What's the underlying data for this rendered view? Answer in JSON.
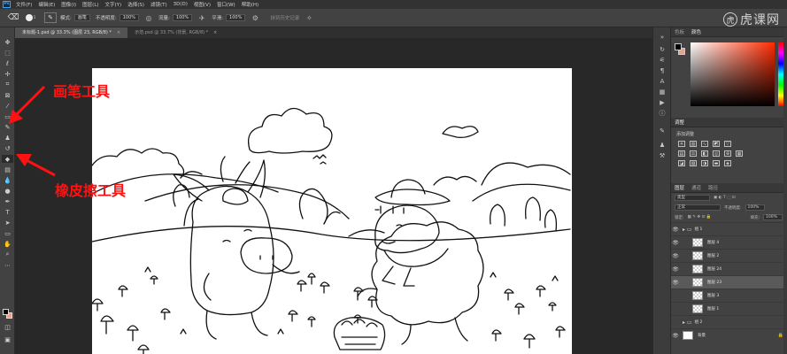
{
  "app": {
    "logo": "Ps"
  },
  "menu": [
    "文件(F)",
    "编辑(E)",
    "图像(I)",
    "图层(L)",
    "文字(Y)",
    "选择(S)",
    "滤镜(T)",
    "3D(D)",
    "视图(V)",
    "窗口(W)",
    "帮助(H)"
  ],
  "options": {
    "tool_icon": "eraser-icon",
    "brush_size": "1",
    "mode_label": "模式:",
    "mode_value": "画笔",
    "opacity_label": "不透明度:",
    "opacity_value": "100%",
    "flow_label": "流量:",
    "flow_value": "100%",
    "smooth_label": "平滑:",
    "smooth_value": "100%",
    "history_label": "抹到历史记录"
  },
  "watermark": {
    "logo": "虎",
    "text": "虎课网"
  },
  "tabs": [
    {
      "label": "未标题-1.psd @ 33.3% (图层 23, RGB/8) *",
      "close": "×"
    },
    {
      "label": "示范.psd @ 33.7% (背景, RGB/8) *",
      "close": "×"
    }
  ],
  "annotations": {
    "brush_tool": "画笔工具",
    "eraser_tool": "橡皮擦工具"
  },
  "panels": {
    "color_tabs": [
      "色板",
      "颜色"
    ],
    "adjust_tab": "调整",
    "adjust_title": "添加调整",
    "layers_tabs": [
      "图层",
      "通道",
      "路径"
    ],
    "filter_kind": "类型",
    "blend_mode": "正常",
    "opacity_label": "不透明度:",
    "opacity_value": "100%",
    "lock_label": "锁定:",
    "fill_label": "填充:",
    "fill_value": "100%",
    "layers": [
      {
        "name": "组 1",
        "type": "group",
        "visible": true
      },
      {
        "name": "图层 4",
        "type": "layer",
        "visible": true
      },
      {
        "name": "图层 2",
        "type": "layer",
        "visible": true
      },
      {
        "name": "图层 24",
        "type": "layer",
        "visible": true
      },
      {
        "name": "图层 23",
        "type": "layer",
        "visible": true,
        "selected": true
      },
      {
        "name": "图层 3",
        "type": "layer",
        "visible": false
      },
      {
        "name": "图层 1",
        "type": "layer",
        "visible": false
      },
      {
        "name": "组 2",
        "type": "group",
        "visible": false
      },
      {
        "name": "背景",
        "type": "background",
        "visible": true,
        "lock": "🔒"
      }
    ]
  },
  "colors": {
    "foreground": "#000000",
    "background": "#e8a090",
    "annotation": "#ff1111"
  }
}
